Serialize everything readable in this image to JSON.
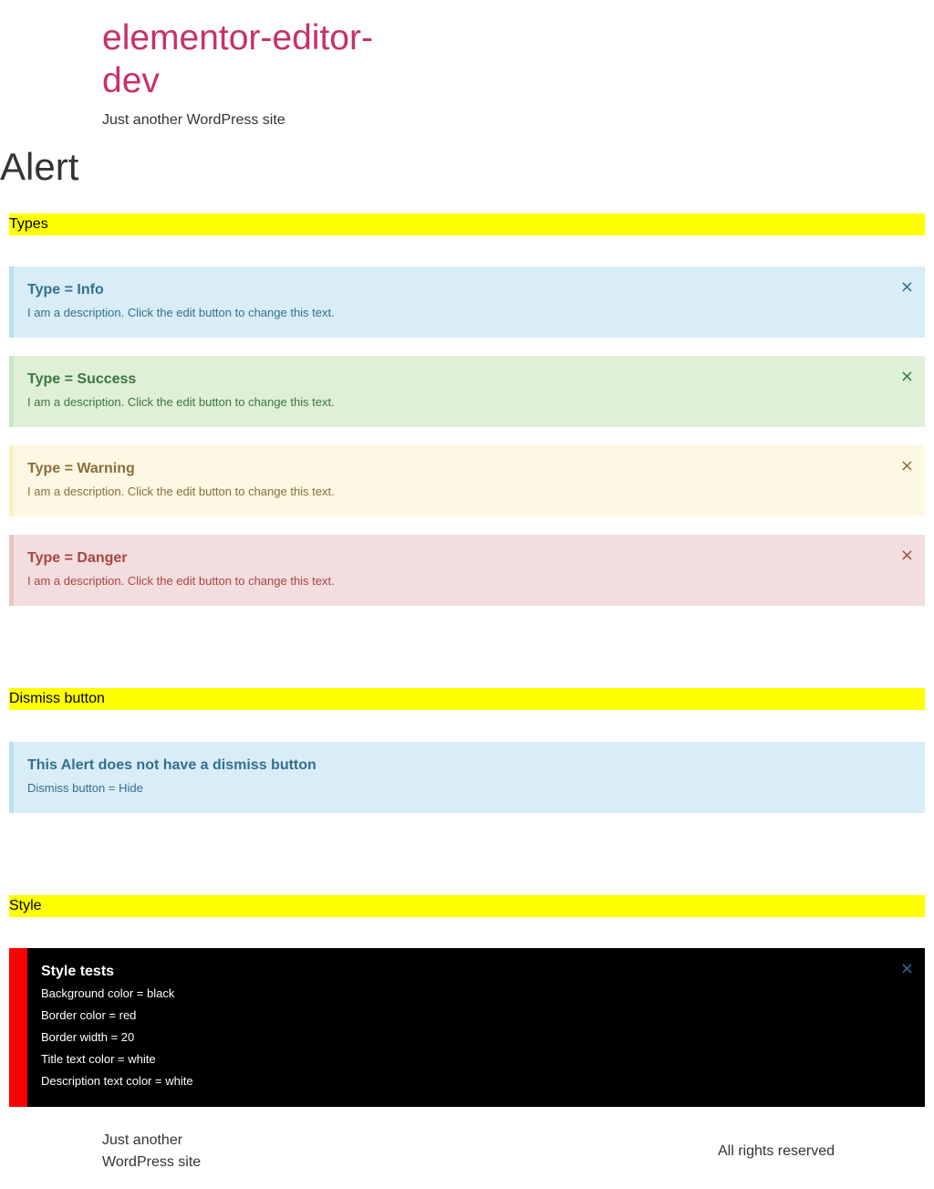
{
  "site": {
    "title": "elementor-editor-dev",
    "description": "Just another WordPress site"
  },
  "page": {
    "title": "Alert"
  },
  "sections": {
    "types": "Types",
    "dismiss": "Dismiss button",
    "style": "Style"
  },
  "alerts": {
    "info": {
      "title": "Type = Info",
      "description": "I am a description. Click the edit button to change this text."
    },
    "success": {
      "title": "Type = Success",
      "description": "I am a description. Click the edit button to change this text."
    },
    "warning": {
      "title": "Type = Warning",
      "description": "I am a description. Click the edit button to change this text."
    },
    "danger": {
      "title": "Type = Danger",
      "description": "I am a description. Click the edit button to change this text."
    },
    "no_dismiss": {
      "title": "This Alert does not have a dismiss button",
      "description": "Dismiss button = Hide"
    },
    "style": {
      "title": "Style tests",
      "lines": [
        "Background color = black",
        "Border color = red",
        "Border width = 20",
        "Title text color = white",
        "Description text color = white"
      ]
    },
    "dismiss_glyph": "×"
  },
  "colors": {
    "site_title": "#c7306b",
    "section_label_bg": "#ffff00",
    "info_bg": "#d9edf7",
    "success_bg": "#dff0d8",
    "warning_bg": "#fcf8e3",
    "danger_bg": "#f2dede",
    "style_bg": "#000000",
    "style_border": "#ff0000"
  },
  "footer": {
    "description": "Just another WordPress site",
    "rights": "All rights reserved"
  }
}
